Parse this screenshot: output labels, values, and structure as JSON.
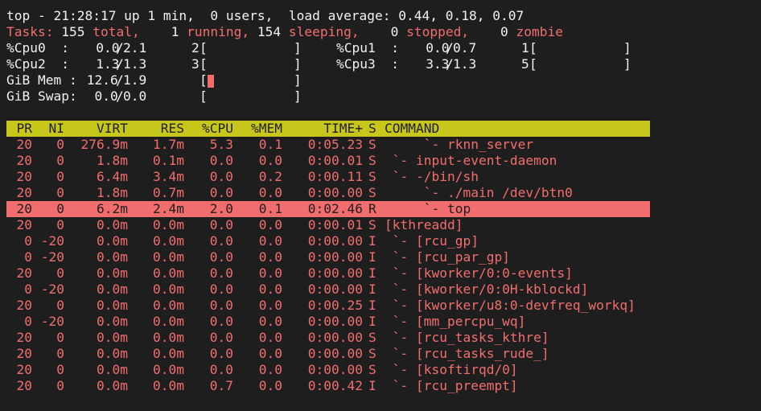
{
  "summary": {
    "uptime_line": "top - 21:28:17 up 1 min,  0 users,  load average: 0.44, 0.18, 0.07",
    "tasks": {
      "label": "Tasks:",
      "total": " 155",
      "total_label": " total,",
      "running": "    1",
      "running_label": " running,",
      "sleeping": " 154",
      "sleeping_label": " sleeping,",
      "stopped": "    0",
      "stopped_label": " stopped,",
      "zombie": "    0",
      "zombie_label": " zombie"
    },
    "cpu0": {
      "label": "%Cpu0  :",
      "user": "   0.0",
      "sep": "/",
      "sys": "2.1",
      "bar_num": "2",
      "bar": "[           ]"
    },
    "cpu1": {
      "label": "%Cpu1  :",
      "user": "   0.0",
      "sep": "/",
      "sys": "0.7",
      "bar_num": "1",
      "bar": "[           ]"
    },
    "cpu2": {
      "label": "%Cpu2  :",
      "user": "   1.3",
      "sep": "/",
      "sys": "1.3",
      "bar_num": "3",
      "bar": "[           ]"
    },
    "cpu3": {
      "label": "%Cpu3  :",
      "user": "   3.3",
      "sep": "/",
      "sys": "1.3",
      "bar_num": "5",
      "bar": "[           ]"
    },
    "mem": {
      "label": "GiB Mem :",
      "used": " 12.6",
      "sep": "/",
      "total": "1.9",
      "bar": "[           ]"
    },
    "swap": {
      "label": "GiB Swap:",
      "used": "  0.0",
      "sep": "/",
      "total": "0.0",
      "bar": "[           ]"
    }
  },
  "columns": {
    "pr": "PR",
    "ni": "NI",
    "virt": "VIRT",
    "res": "RES",
    "cpu": "%CPU",
    "mem": "%MEM",
    "time": "TIME+",
    "s": "S",
    "command": "COMMAND"
  },
  "processes": [
    {
      "pr": "20",
      "ni": "0",
      "virt": "276.9m",
      "res": "1.7m",
      "cpu": "5.3",
      "mem": "0.1",
      "time": "0:05.23",
      "s": "S",
      "command": "     `- rknn_server"
    },
    {
      "pr": "20",
      "ni": "0",
      "virt": "1.8m",
      "res": "0.1m",
      "cpu": "0.0",
      "mem": "0.0",
      "time": "0:00.01",
      "s": "S",
      "command": " `- input-event-daemon"
    },
    {
      "pr": "20",
      "ni": "0",
      "virt": "6.4m",
      "res": "3.4m",
      "cpu": "0.0",
      "mem": "0.2",
      "time": "0:00.11",
      "s": "S",
      "command": " `- -/bin/sh"
    },
    {
      "pr": "20",
      "ni": "0",
      "virt": "1.8m",
      "res": "0.7m",
      "cpu": "0.0",
      "mem": "0.0",
      "time": "0:00.00",
      "s": "S",
      "command": "     `- ./main /dev/btn0"
    },
    {
      "pr": "20",
      "ni": "0",
      "virt": "6.2m",
      "res": "2.4m",
      "cpu": "2.0",
      "mem": "0.1",
      "time": "0:02.46",
      "s": "R",
      "command": "     `- top",
      "selected": true
    },
    {
      "pr": "20",
      "ni": "0",
      "virt": "0.0m",
      "res": "0.0m",
      "cpu": "0.0",
      "mem": "0.0",
      "time": "0:00.01",
      "s": "S",
      "command": "[kthreadd]"
    },
    {
      "pr": "0",
      "ni": "-20",
      "virt": "0.0m",
      "res": "0.0m",
      "cpu": "0.0",
      "mem": "0.0",
      "time": "0:00.00",
      "s": "I",
      "command": " `- [rcu_gp]"
    },
    {
      "pr": "0",
      "ni": "-20",
      "virt": "0.0m",
      "res": "0.0m",
      "cpu": "0.0",
      "mem": "0.0",
      "time": "0:00.00",
      "s": "I",
      "command": " `- [rcu_par_gp]"
    },
    {
      "pr": "20",
      "ni": "0",
      "virt": "0.0m",
      "res": "0.0m",
      "cpu": "0.0",
      "mem": "0.0",
      "time": "0:00.00",
      "s": "I",
      "command": " `- [kworker/0:0-events]"
    },
    {
      "pr": "0",
      "ni": "-20",
      "virt": "0.0m",
      "res": "0.0m",
      "cpu": "0.0",
      "mem": "0.0",
      "time": "0:00.00",
      "s": "I",
      "command": " `- [kworker/0:0H-kblockd]"
    },
    {
      "pr": "20",
      "ni": "0",
      "virt": "0.0m",
      "res": "0.0m",
      "cpu": "0.0",
      "mem": "0.0",
      "time": "0:00.25",
      "s": "I",
      "command": " `- [kworker/u8:0-devfreq_workq]"
    },
    {
      "pr": "0",
      "ni": "-20",
      "virt": "0.0m",
      "res": "0.0m",
      "cpu": "0.0",
      "mem": "0.0",
      "time": "0:00.00",
      "s": "I",
      "command": " `- [mm_percpu_wq]"
    },
    {
      "pr": "20",
      "ni": "0",
      "virt": "0.0m",
      "res": "0.0m",
      "cpu": "0.0",
      "mem": "0.0",
      "time": "0:00.00",
      "s": "S",
      "command": " `- [rcu_tasks_kthre]"
    },
    {
      "pr": "20",
      "ni": "0",
      "virt": "0.0m",
      "res": "0.0m",
      "cpu": "0.0",
      "mem": "0.0",
      "time": "0:00.00",
      "s": "S",
      "command": " `- [rcu_tasks_rude_]"
    },
    {
      "pr": "20",
      "ni": "0",
      "virt": "0.0m",
      "res": "0.0m",
      "cpu": "0.0",
      "mem": "0.0",
      "time": "0:00.00",
      "s": "S",
      "command": " `- [ksoftirqd/0]"
    },
    {
      "pr": "20",
      "ni": "0",
      "virt": "0.0m",
      "res": "0.0m",
      "cpu": "0.7",
      "mem": "0.0",
      "time": "0:00.42",
      "s": "I",
      "command": " `- [rcu_preempt]"
    }
  ],
  "colors": {
    "background": "#1e1e1e",
    "text": "#f2f2f2",
    "accent_red": "#f26e6e",
    "header_bg": "#c7c61a",
    "selected_bg": "#f26e6e"
  }
}
